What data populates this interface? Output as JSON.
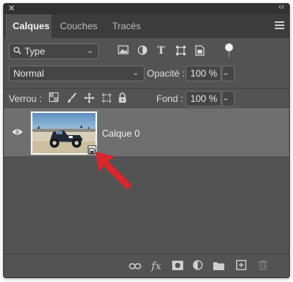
{
  "window": {
    "close_glyph": "✕",
    "collapse_glyph": "‹‹"
  },
  "tabs": [
    {
      "label": "Calques",
      "active": true
    },
    {
      "label": "Couches",
      "active": false
    },
    {
      "label": "Tracés",
      "active": false
    }
  ],
  "filter": {
    "kind_label": "Type",
    "icons": [
      "image-filter-icon",
      "adjustment-filter-icon",
      "text-filter-icon",
      "shape-filter-icon",
      "smart-object-filter-icon"
    ],
    "type_glyph": "T"
  },
  "blend": {
    "mode": "Normal",
    "opacity_label": "Opacité :",
    "opacity_value": "100 %"
  },
  "lock": {
    "label": "Verrou :",
    "fill_label": "Fond :",
    "fill_value": "100 %"
  },
  "layers": [
    {
      "name": "Calque 0",
      "visible": true,
      "smart_object": true
    }
  ],
  "bottom_icons": [
    "link-icon",
    "fx-icon",
    "mask-icon",
    "adjustment-layer-icon",
    "group-folder-icon",
    "new-layer-icon",
    "delete-icon"
  ],
  "fx_glyph": "fx",
  "colors": {
    "panel": "#535353",
    "tabbar": "#3c3c3c",
    "selected_row": "#6f6f6f",
    "annotation_arrow": "#d9262b"
  }
}
